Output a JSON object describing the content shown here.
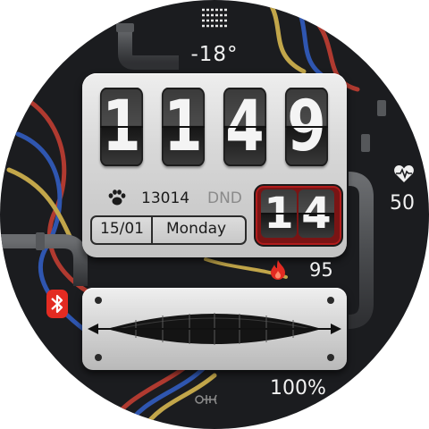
{
  "weather": {
    "icon": "fog-icon",
    "temperature": "-18°"
  },
  "heart_rate": {
    "icon": "heart-icon",
    "value": "50"
  },
  "time": {
    "h1": "1",
    "h2": "1",
    "m1": "4",
    "m2": "9"
  },
  "steps": {
    "icon": "paw-icon",
    "value": "13014"
  },
  "dnd_label": "DND",
  "date": {
    "day_month": "15/01",
    "weekday": "Monday"
  },
  "seconds": {
    "s1": "1",
    "s2": "4"
  },
  "calories": {
    "icon": "flame-icon",
    "value": "95"
  },
  "bluetooth": {
    "icon": "bluetooth-icon"
  },
  "battery": {
    "value": "100%",
    "level": 1.0
  },
  "fish_icon": "fish-bone-icon",
  "colors": {
    "accent": "#e32b22",
    "seconds_frame": "#8b1515",
    "face": "#1b1c1f"
  }
}
